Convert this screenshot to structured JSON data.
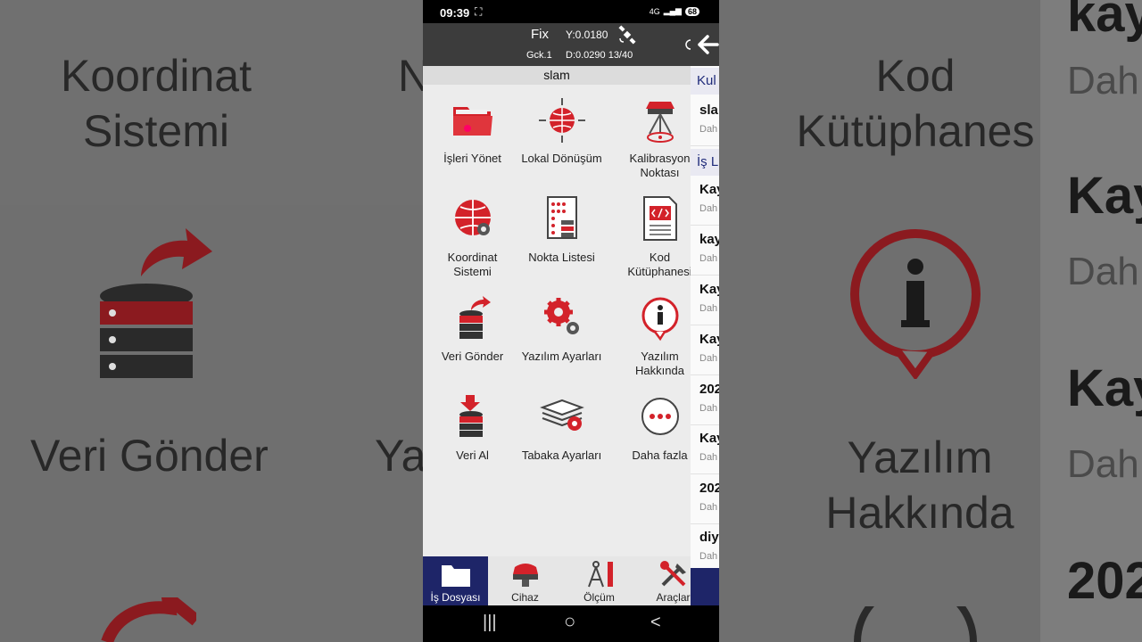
{
  "background": {
    "left": {
      "coord_title": "Koordinat\nSistemi",
      "veri_gonder": "Veri Gönder",
      "edge_letter_top": "N",
      "edge_letter_mid": "Ya"
    },
    "right": {
      "kod_title": "Kod\nKütüphanes",
      "yazilim_title": "Yazılım\nHakkında",
      "kay_1": "kay",
      "dah_1": "Dah",
      "kay_2": "Kay",
      "dah_2": "Dah",
      "kay_3": "Kay",
      "dah_3": "Dah",
      "num_1": "202"
    }
  },
  "status_bar": {
    "time": "09:39",
    "battery": "68",
    "signal": "4G"
  },
  "top_bar": {
    "fix": "Fix",
    "y": "Y:0.0180",
    "gck": "Gck.1",
    "d": "D:0.0290 13/40"
  },
  "job_name": "slam",
  "tiles": [
    {
      "label": "İşleri Yönet",
      "icon": "folder-icon"
    },
    {
      "label": "Lokal Dönüşüm",
      "icon": "globe-arrows-icon"
    },
    {
      "label": "Kalibrasyon\nNoktası",
      "icon": "gnss-receiver-icon"
    },
    {
      "label": "Koordinat\nSistemi",
      "icon": "globe-gear-icon"
    },
    {
      "label": "Nokta Listesi",
      "icon": "point-list-icon"
    },
    {
      "label": "Kod\nKütüphanesi",
      "icon": "code-library-icon"
    },
    {
      "label": "Veri Gönder",
      "icon": "database-upload-icon"
    },
    {
      "label": "Yazılım Ayarları",
      "icon": "gears-icon"
    },
    {
      "label": "Yazılım\nHakkında",
      "icon": "info-icon"
    },
    {
      "label": "Veri Al",
      "icon": "database-download-icon"
    },
    {
      "label": "Tabaka Ayarları",
      "icon": "layers-gear-icon"
    },
    {
      "label": "Daha fazla",
      "icon": "more-icon"
    }
  ],
  "side_panel": {
    "header_1": "Kul",
    "current": {
      "name": "sla",
      "sub": "Dah"
    },
    "header_2": "İş L",
    "items": [
      {
        "name": "Kay",
        "sub": "Dah"
      },
      {
        "name": "kay",
        "sub": "Dah"
      },
      {
        "name": "Kay",
        "sub": "Dah"
      },
      {
        "name": "Kay",
        "sub": "Dah"
      },
      {
        "name": "202",
        "sub": "Dah"
      },
      {
        "name": "Kay",
        "sub": "Dah"
      },
      {
        "name": "202",
        "sub": "Dah"
      },
      {
        "name": "diya",
        "sub": "Dah"
      }
    ]
  },
  "bottom_nav": [
    {
      "label": "İş Dosyası",
      "icon": "job-folder-icon",
      "active": true
    },
    {
      "label": "Cihaz",
      "icon": "device-icon",
      "active": false
    },
    {
      "label": "Ölçüm",
      "icon": "survey-icon",
      "active": false
    },
    {
      "label": "Araçlar",
      "icon": "tools-icon",
      "active": false
    }
  ],
  "system_nav": {
    "recents": "|||",
    "home": "○",
    "back": "<"
  },
  "colors": {
    "accent": "#d3222a",
    "nav_active": "#1e2568",
    "top_bar": "#3c3c3c"
  }
}
